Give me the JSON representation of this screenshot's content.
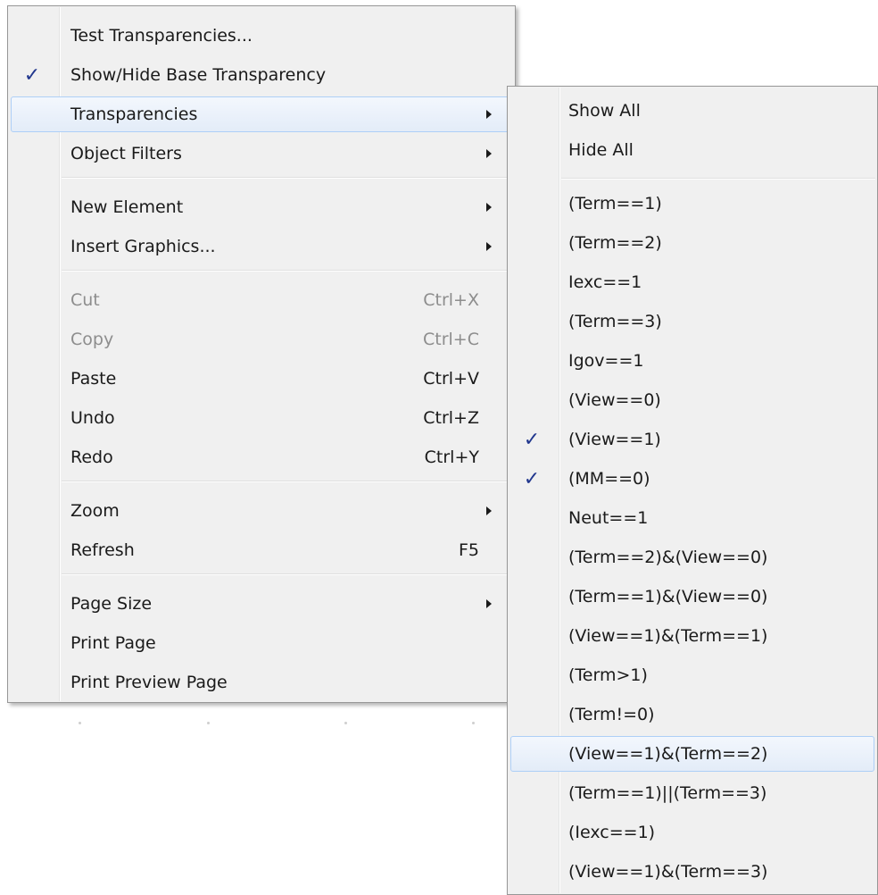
{
  "main_menu": {
    "items": [
      {
        "label": "Test Transparencies...",
        "checked": false,
        "submenu": false,
        "disabled": false,
        "shortcut": ""
      },
      {
        "label": "Show/Hide Base Transparency",
        "checked": true,
        "submenu": false,
        "disabled": false,
        "shortcut": ""
      },
      {
        "label": "Transparencies",
        "checked": false,
        "submenu": true,
        "disabled": false,
        "shortcut": "",
        "highlighted": true
      },
      {
        "label": "Object Filters",
        "checked": false,
        "submenu": true,
        "disabled": false,
        "shortcut": ""
      },
      {
        "label": "New Element",
        "checked": false,
        "submenu": true,
        "disabled": false,
        "shortcut": ""
      },
      {
        "label": "Insert Graphics...",
        "checked": false,
        "submenu": true,
        "disabled": false,
        "shortcut": ""
      },
      {
        "label": "Cut",
        "checked": false,
        "submenu": false,
        "disabled": true,
        "shortcut": "Ctrl+X"
      },
      {
        "label": "Copy",
        "checked": false,
        "submenu": false,
        "disabled": true,
        "shortcut": "Ctrl+C"
      },
      {
        "label": "Paste",
        "checked": false,
        "submenu": false,
        "disabled": false,
        "shortcut": "Ctrl+V"
      },
      {
        "label": "Undo",
        "checked": false,
        "submenu": false,
        "disabled": false,
        "shortcut": "Ctrl+Z"
      },
      {
        "label": "Redo",
        "checked": false,
        "submenu": false,
        "disabled": false,
        "shortcut": "Ctrl+Y"
      },
      {
        "label": "Zoom",
        "checked": false,
        "submenu": true,
        "disabled": false,
        "shortcut": ""
      },
      {
        "label": "Refresh",
        "checked": false,
        "submenu": false,
        "disabled": false,
        "shortcut": "F5"
      },
      {
        "label": "Page Size",
        "checked": false,
        "submenu": true,
        "disabled": false,
        "shortcut": ""
      },
      {
        "label": "Print Page",
        "checked": false,
        "submenu": false,
        "disabled": false,
        "shortcut": ""
      },
      {
        "label": "Print Preview Page",
        "checked": false,
        "submenu": false,
        "disabled": false,
        "shortcut": ""
      }
    ]
  },
  "transparencies_submenu": {
    "items": [
      {
        "label": "Show All",
        "checked": false
      },
      {
        "label": "Hide All",
        "checked": false
      },
      {
        "label": "(Term==1)",
        "checked": false
      },
      {
        "label": "(Term==2)",
        "checked": false
      },
      {
        "label": "Iexc==1",
        "checked": false
      },
      {
        "label": "(Term==3)",
        "checked": false
      },
      {
        "label": "Igov==1",
        "checked": false
      },
      {
        "label": "(View==0)",
        "checked": false
      },
      {
        "label": "(View==1)",
        "checked": true
      },
      {
        "label": "(MM==0)",
        "checked": true
      },
      {
        "label": "Neut==1",
        "checked": false
      },
      {
        "label": "(Term==2)&(View==0)",
        "checked": false
      },
      {
        "label": "(Term==1)&(View==0)",
        "checked": false
      },
      {
        "label": "(View==1)&(Term==1)",
        "checked": false
      },
      {
        "label": "(Term>1)",
        "checked": false
      },
      {
        "label": "(Term!=0)",
        "checked": false
      },
      {
        "label": "(View==1)&(Term==2)",
        "checked": false,
        "highlighted": true
      },
      {
        "label": "(Term==1)||(Term==3)",
        "checked": false
      },
      {
        "label": "(Iexc==1)",
        "checked": false
      },
      {
        "label": "(View==1)&(Term==3)",
        "checked": false
      }
    ]
  },
  "icons": {
    "check": "checkmark-icon",
    "submenu": "submenu-arrow-icon"
  },
  "colors": {
    "check": "#21378e",
    "highlight_border": "#aecff7",
    "disabled_text": "#8d8d8d"
  }
}
